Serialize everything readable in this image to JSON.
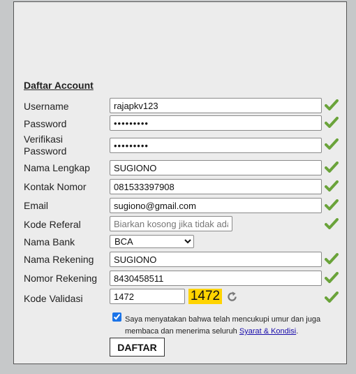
{
  "form": {
    "title": "Daftar Account",
    "username": {
      "label": "Username",
      "value": "rajapkv123"
    },
    "password": {
      "label": "Password",
      "value": "rajapkv12"
    },
    "verify_password": {
      "label_line1": "Verifikasi",
      "label_line2": "Password",
      "value": "rajapkv12"
    },
    "full_name": {
      "label": "Nama Lengkap",
      "value": "SUGIONO"
    },
    "phone": {
      "label": "Kontak Nomor",
      "value": "081533397908"
    },
    "email": {
      "label": "Email",
      "value": "sugiono@gmail.com"
    },
    "referral": {
      "label": "Kode Referal",
      "value": "",
      "placeholder": "Biarkan kosong jika tidak ada"
    },
    "bank": {
      "label": "Nama Bank",
      "selected": "BCA"
    },
    "account_name": {
      "label": "Nama Rekening",
      "value": "SUGIONO"
    },
    "account_number": {
      "label": "Nomor Rekening",
      "value": "8430458511"
    },
    "validation": {
      "label": "Kode Validasi",
      "value": "1472",
      "captcha": "1472"
    },
    "agreement": {
      "checked": true,
      "text": "Saya menyatakan bahwa telah mencukupi umur dan juga membaca dan menerima seluruh ",
      "link": "Syarat & Kondisi",
      "suffix": "."
    },
    "submit_label": "DAFTAR"
  },
  "colors": {
    "check": "#6aa33a",
    "captcha_bg": "#ffd400",
    "link": "#1a0dab"
  }
}
